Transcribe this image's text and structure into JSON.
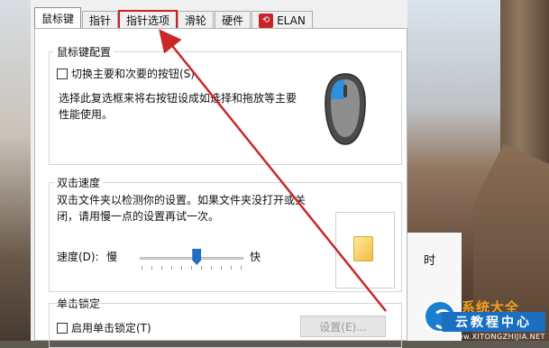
{
  "tabs": [
    {
      "label": "鼠标键"
    },
    {
      "label": "指针"
    },
    {
      "label": "指针选项"
    },
    {
      "label": "滑轮"
    },
    {
      "label": "硬件"
    },
    {
      "label": "ELAN"
    }
  ],
  "button_config": {
    "title": "鼠标键配置",
    "swap_label": "切换主要和次要的按钮(S)",
    "description_line1": "选择此复选框来将右按钮设成如选择和拖放等主要",
    "description_line2": "性能使用。"
  },
  "double_click": {
    "title": "双击速度",
    "description_line1": "双击文件夹以检测你的设置。如果文件夹没打开或关",
    "description_line2": "闭，请用慢一点的设置再试一次。",
    "speed_label": "速度(D):",
    "slow_label": "慢",
    "fast_label": "快",
    "speed_value": 0.55
  },
  "click_lock": {
    "title": "单击锁定",
    "enable_label": "启用单击锁定(T)",
    "settings_button": "设置(E)..."
  },
  "background_text": "时",
  "watermark": {
    "title": "系统大全",
    "badge": "云教程中心",
    "url": "www.XITONGZHIJIA.NET"
  },
  "colors": {
    "highlight_box": "#d02020",
    "arrow": "#c82828",
    "slider_thumb": "#1e6fc0"
  }
}
